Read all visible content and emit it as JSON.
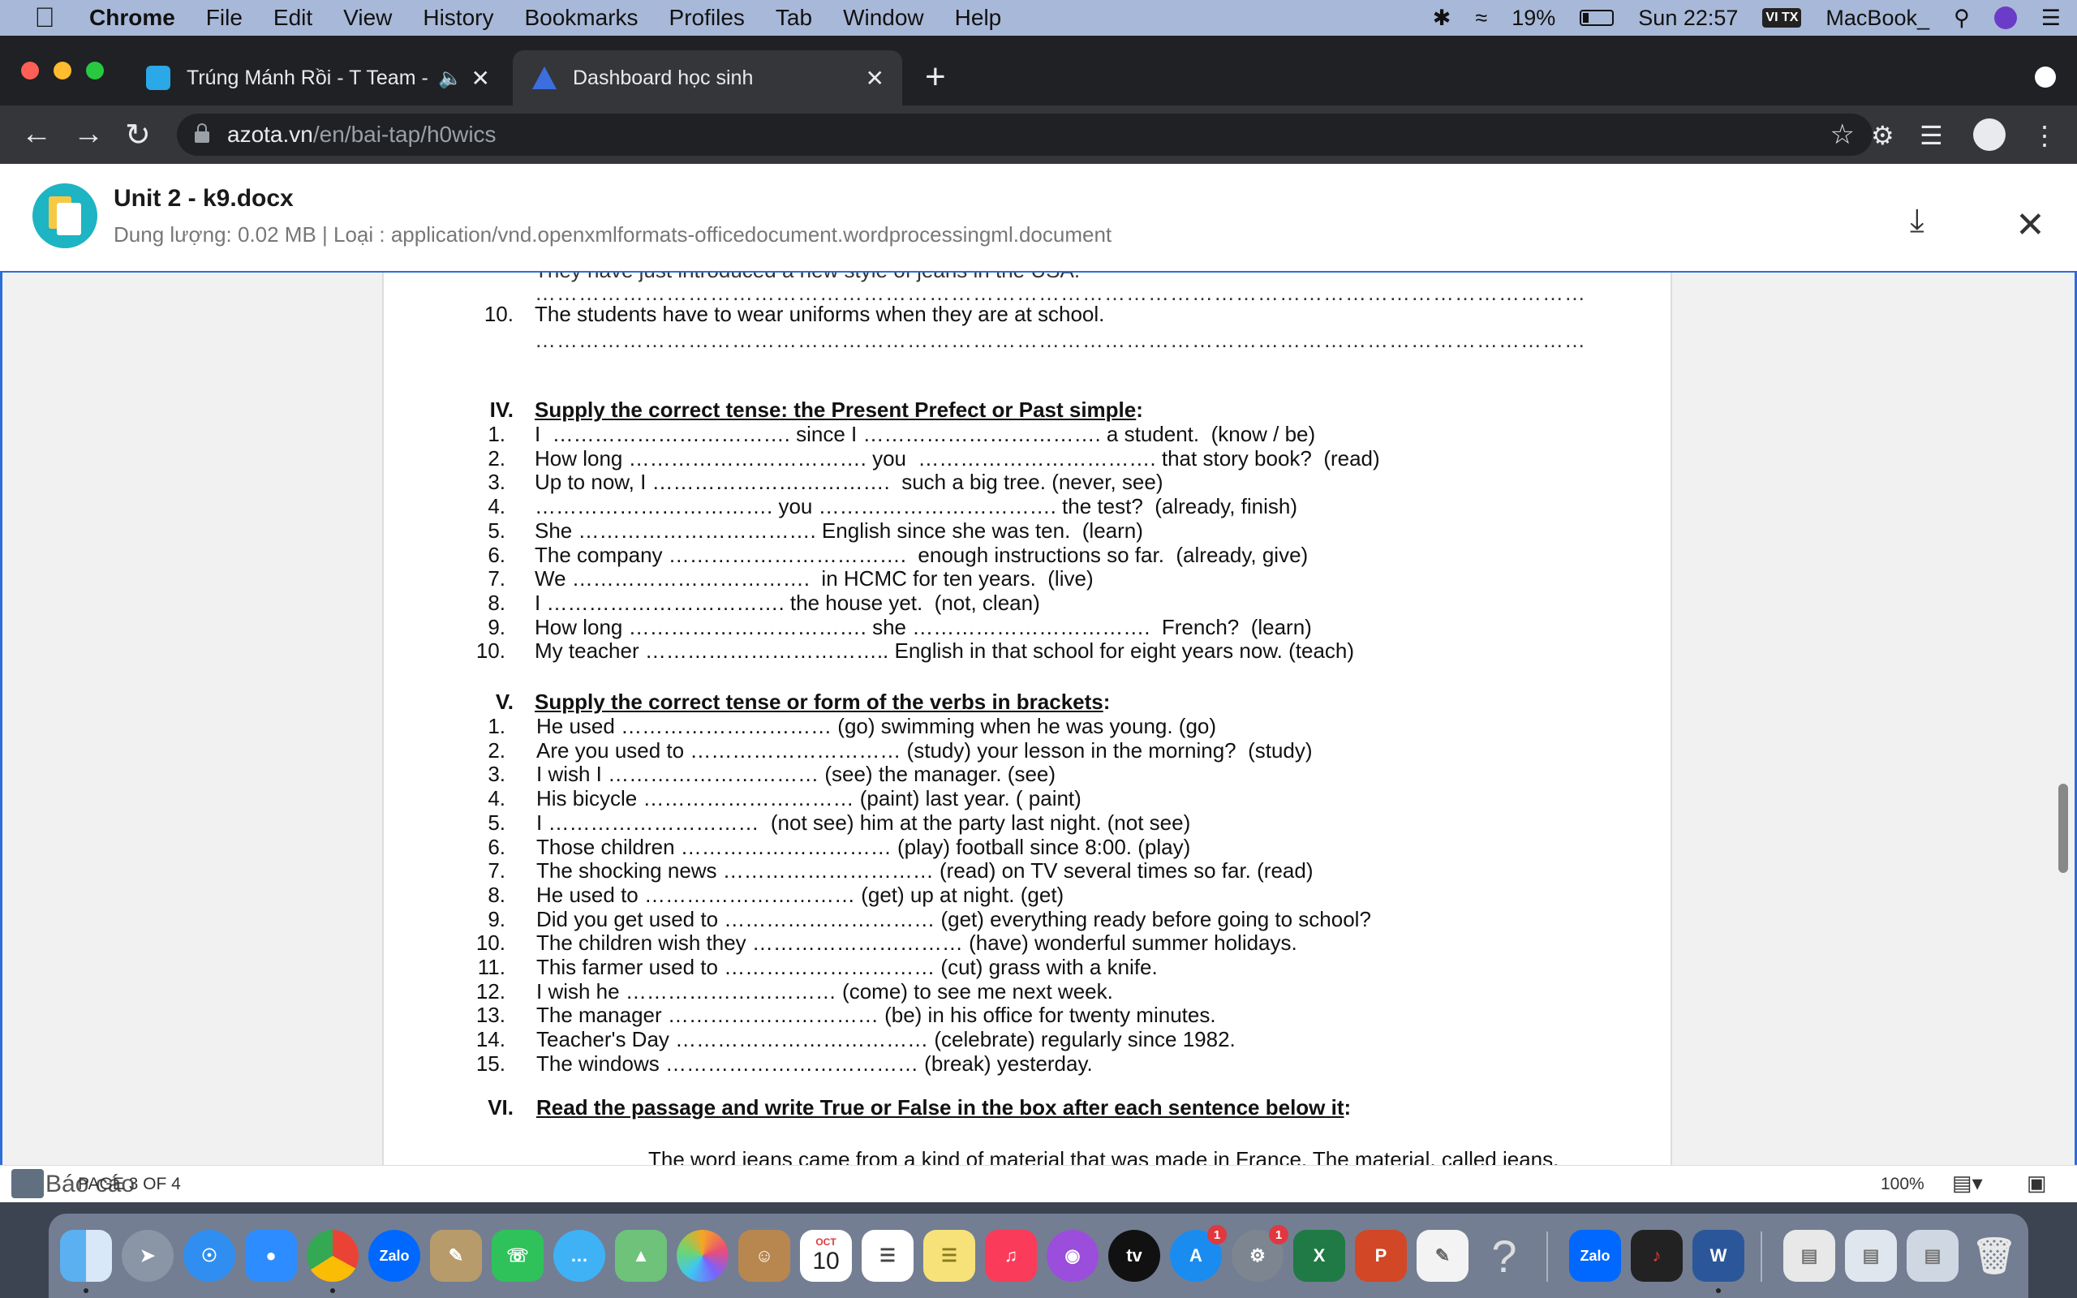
{
  "menubar": {
    "app_name": "Chrome",
    "items": [
      "File",
      "Edit",
      "View",
      "History",
      "Bookmarks",
      "Profiles",
      "Tab",
      "Window",
      "Help"
    ],
    "battery": "19%",
    "clock": "Sun 22:57",
    "input_source": "VI TX",
    "hostname": "MacBook_"
  },
  "tabs": [
    {
      "title": "Trúng Mánh Rồi - T Team -",
      "favicon_color": "#2aa8e8"
    },
    {
      "title": "Dashboard học sinh",
      "favicon_color": "#3b6fe0"
    }
  ],
  "omnibox": {
    "host": "azota.vn",
    "path": "/en/bai-tap/h0wics"
  },
  "file": {
    "title": "Unit 2 - k9.docx",
    "meta": "Dung lượng: 0.02 MB | Loại : application/vnd.openxmlformats-officedocument.wordprocessingml.document"
  },
  "doc": {
    "top_cut_text": "They have just introduced a new style of jeans in the USA.",
    "rewrite_item_num": "10.",
    "rewrite_item_text": "The students have to wear uniforms when they are at school.",
    "dotted_line": "………………………………………………………………………………………………………………………………",
    "section4": {
      "roman": "IV.",
      "title": "Supply the correct tense: the Present Prefect or Past simple",
      "items": [
        {
          "n": "1.",
          "t": "I  ……………………………. since I ……………………………. a student.  (know / be)"
        },
        {
          "n": "2.",
          "t": "How long ……………………………. you  ……………………………. that story book?  (read)"
        },
        {
          "n": "3.",
          "t": "Up to now, I …………………………….  such a big tree. (never, see)"
        },
        {
          "n": "4.",
          "t": "……………………………. you ……………………………. the test?  (already, finish)"
        },
        {
          "n": "5.",
          "t": "She ……………………………. English since she was ten.  (learn)"
        },
        {
          "n": "6.",
          "t": "The company …………………………….  enough instructions so far.  (already, give)"
        },
        {
          "n": "7.",
          "t": "We …………………………….  in HCMC for ten years.  (live)"
        },
        {
          "n": "8.",
          "t": "I ……………………………. the house yet.  (not, clean)"
        },
        {
          "n": "9.",
          "t": "How long ……………………………. she …………………………….  French?  (learn)"
        },
        {
          "n": "10.",
          "t": "My teacher …………………………….. English in that school for eight years now. (teach)"
        }
      ]
    },
    "section5": {
      "roman": "V.",
      "title": "Supply the correct tense or form of the verbs in brackets",
      "items": [
        {
          "n": "1.",
          "t": "He used ………………………… (go) swimming when he was young. (go)"
        },
        {
          "n": "2.",
          "t": "Are you used to ………………………… (study) your lesson in the morning?  (study)"
        },
        {
          "n": "3.",
          "t": "I wish I ………………………… (see) the manager. (see)"
        },
        {
          "n": "4.",
          "t": "His bicycle ………………………… (paint) last year. ( paint)"
        },
        {
          "n": "5.",
          "t": "I …………………………  (not see) him at the party last night. (not see)"
        },
        {
          "n": "6.",
          "t": "Those children ………………………… (play) football since 8:00. (play)"
        },
        {
          "n": "7.",
          "t": "The shocking news ………………………… (read) on TV several times so far. (read)"
        },
        {
          "n": "8.",
          "t": "He used to ………………………… (get) up at night. (get)"
        },
        {
          "n": "9.",
          "t": "Did you get used to ………………………… (get) everything ready before going to school?"
        },
        {
          "n": "10.",
          "t": "The children wish they ………………………… (have) wonderful summer holidays."
        },
        {
          "n": "11.",
          "t": "This farmer used to ………………………… (cut) grass with a knife."
        },
        {
          "n": "12.",
          "t": "I wish he ………………………… (come) to see me next week."
        },
        {
          "n": "13.",
          "t": "The manager ………………………… (be) in his office for twenty minutes."
        },
        {
          "n": "14.",
          "t": "Teacher's Day ……………………………… (celebrate) regularly since 1982."
        },
        {
          "n": "15.",
          "t": "The windows ……………………………… (break) yesterday."
        }
      ]
    },
    "section6": {
      "roman": "VI.",
      "title": "Read the passage and write True or False in the box after each sentence below it"
    },
    "bottom_cut_text": "The word jeans came from a kind of material that was made in France. The material, called jeans,"
  },
  "statusbar": {
    "report_label": "Báo cáo",
    "page_label": "PAGE 3 OF 4",
    "zoom": "100%"
  },
  "dock": {
    "calendar_month": "OCT",
    "calendar_day": "10",
    "zalo_label": "Zalo",
    "tv_label": "tv",
    "excel_letter": "X",
    "ppt_letter": "P",
    "word_letter": "W",
    "help_glyph": "?",
    "appstore_badge": "1",
    "settings_badge": "1"
  }
}
